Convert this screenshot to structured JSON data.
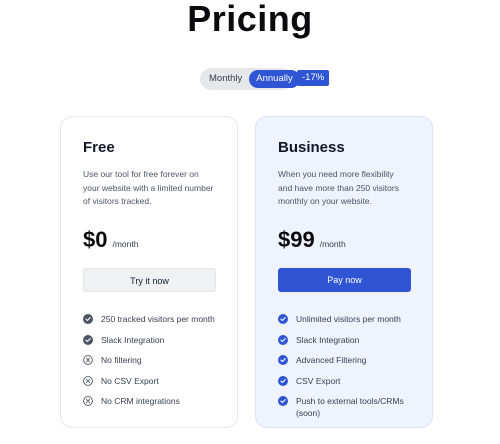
{
  "page": {
    "title": "Pricing"
  },
  "billing_toggle": {
    "monthly_label": "Monthly",
    "annually_label": "Annually",
    "selected": "Annually",
    "discount_badge": "-17%"
  },
  "colors": {
    "accent": "#2f55d4",
    "check_gray": "#4b5563",
    "business_bg": "#eef3fd"
  },
  "plans": [
    {
      "name": "Free",
      "description": "Use our tool for free forever on your website with a limited number of visitors tracked.",
      "price": "$0",
      "period": "/month",
      "cta_label": "Try it now",
      "features": [
        {
          "text": "250 tracked visitors per month",
          "icon": "check-circle-icon"
        },
        {
          "text": "Slack Integration",
          "icon": "check-circle-icon"
        },
        {
          "text": "No filtering",
          "icon": "x-circle-icon"
        },
        {
          "text": "No CSV Export",
          "icon": "x-circle-icon"
        },
        {
          "text": "No CRM integrations",
          "icon": "x-circle-icon"
        }
      ]
    },
    {
      "name": "Business",
      "description": "When you need more flexibility and have more than 250 visitors monthly on your website.",
      "price": "$99",
      "period": "/month",
      "cta_label": "Pay now",
      "features": [
        {
          "text": "Unlimited visitors per month",
          "icon": "check-circle-icon"
        },
        {
          "text": "Slack Integration",
          "icon": "check-circle-icon"
        },
        {
          "text": "Advanced Filtering",
          "icon": "check-circle-icon"
        },
        {
          "text": "CSV Export",
          "icon": "check-circle-icon"
        },
        {
          "text": "Push to external tools/CRMs (soon)",
          "icon": "check-circle-icon"
        }
      ]
    }
  ]
}
